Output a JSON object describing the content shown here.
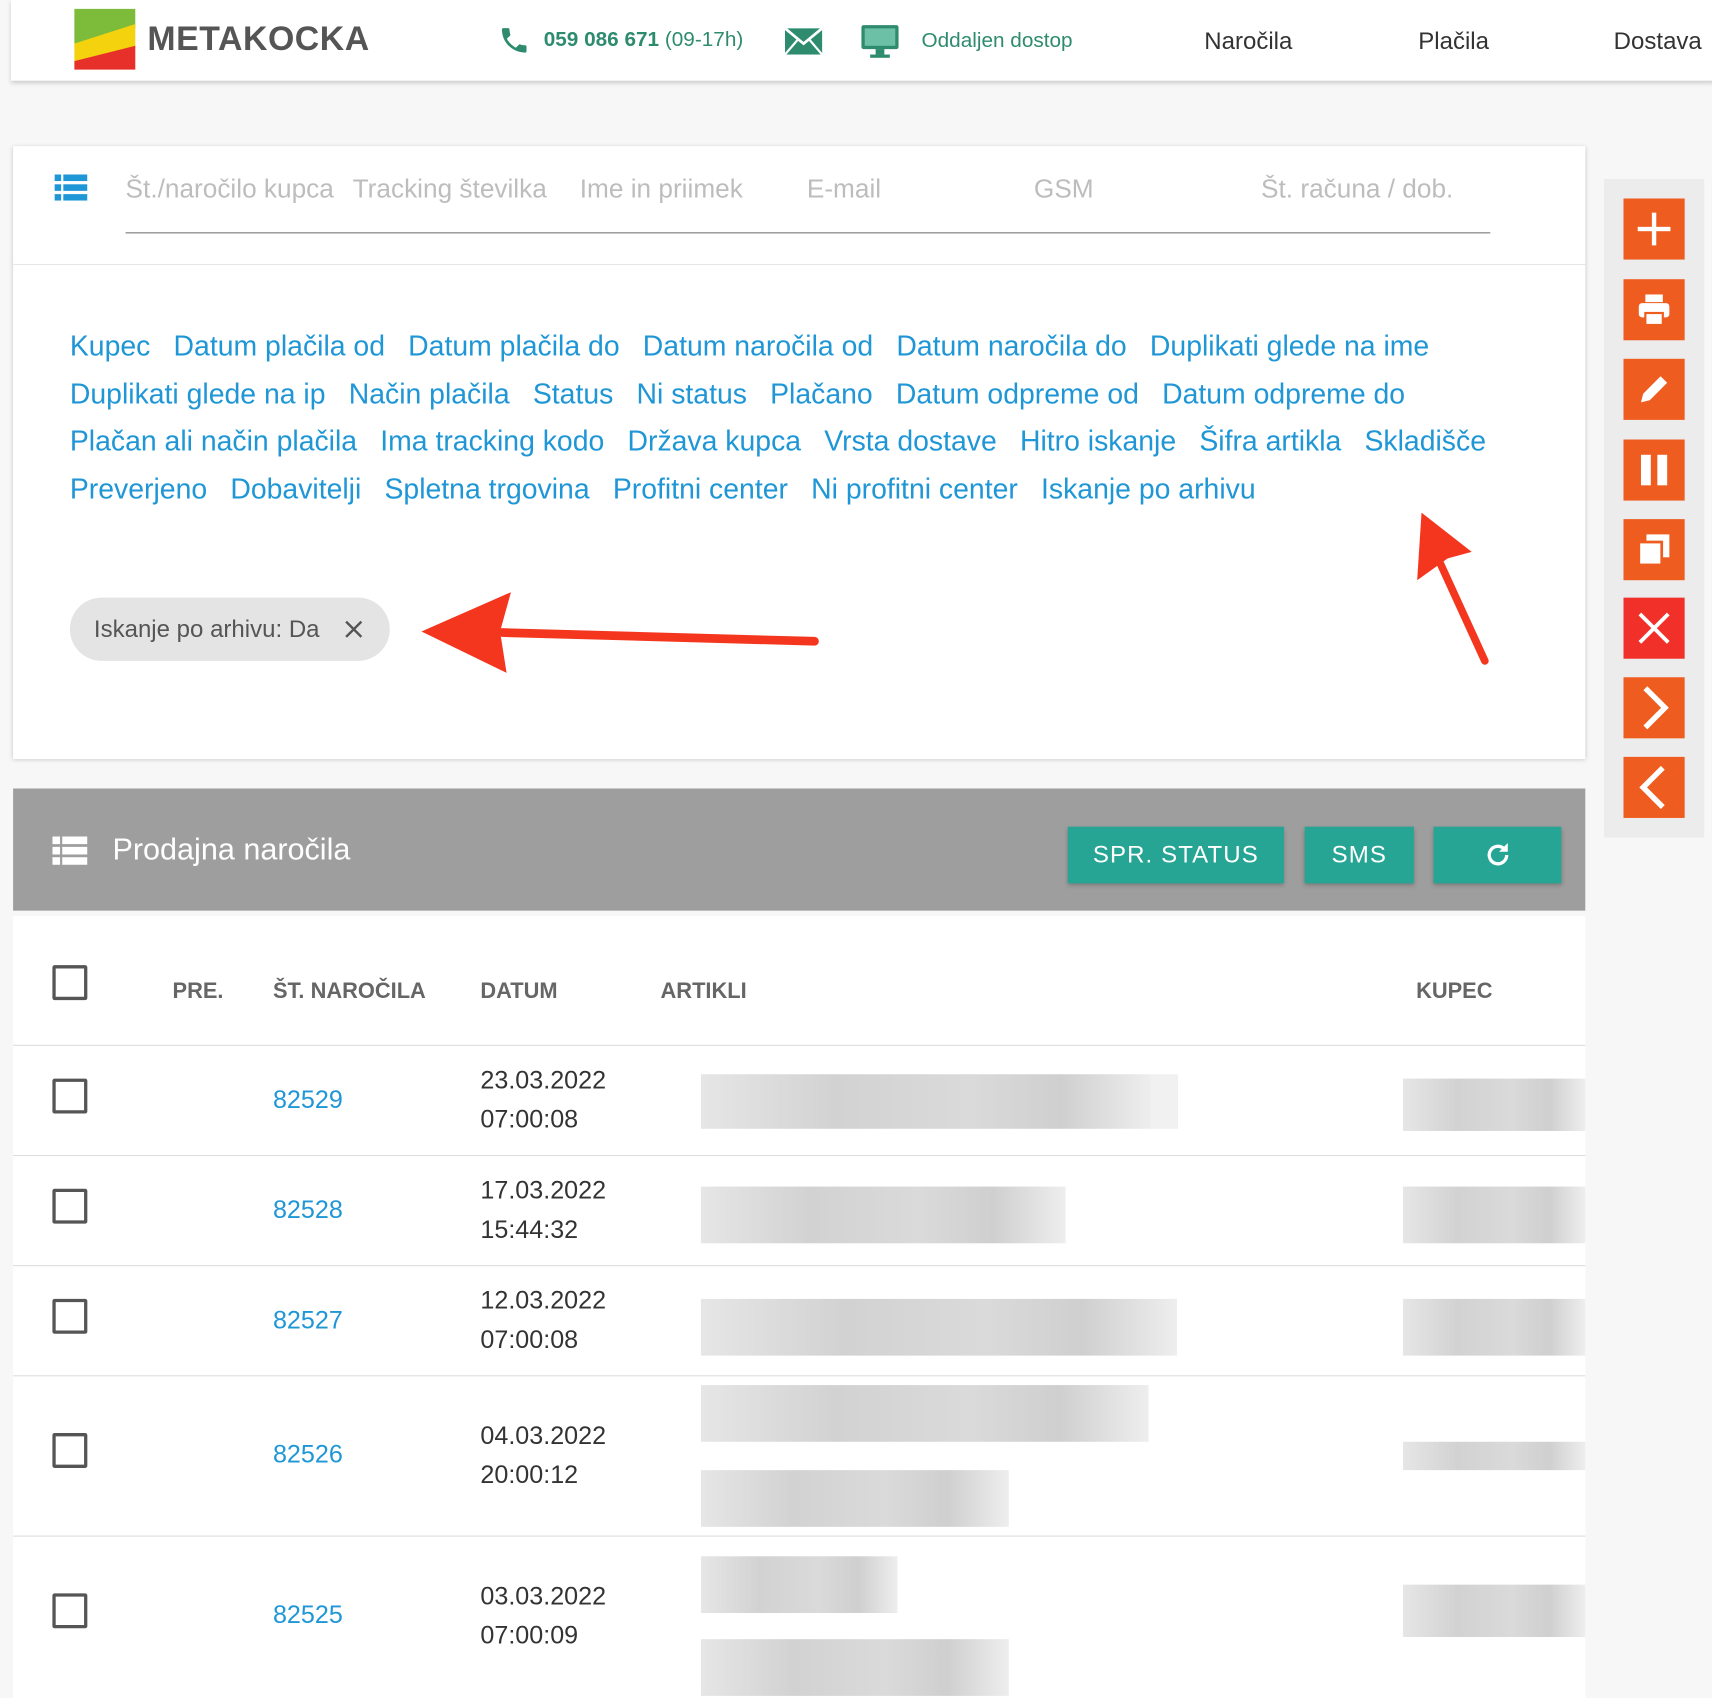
{
  "header": {
    "brand": "METAKOCKA",
    "phone_number": "059 086 671",
    "phone_hours": "(09-17h)",
    "remote_access": "Oddaljen dostop",
    "nav": [
      "Naročila",
      "Plačila",
      "Dostava"
    ]
  },
  "search": {
    "placeholders": [
      "Št./naročilo kupca",
      "Tracking številka",
      "Ime in priimek",
      "E-mail",
      "GSM",
      "Št. računa / dob."
    ]
  },
  "filters": [
    "Kupec",
    "Datum plačila od",
    "Datum plačila do",
    "Datum naročila od",
    "Datum naročila do",
    "Duplikati glede na ime",
    "Duplikati glede na ip",
    "Način plačila",
    "Status",
    "Ni status",
    "Plačano",
    "Datum odpreme od",
    "Datum odpreme do",
    "Plačan ali način plačila",
    "Ima tracking kodo",
    "Država kupca",
    "Vrsta dostave",
    "Hitro iskanje",
    "Šifra artikla",
    "Skladišče",
    "Preverjeno",
    "Dobavitelji",
    "Spletna trgovina",
    "Profitni center",
    "Ni profitni center",
    "Iskanje po arhivu"
  ],
  "active_filter_chip": "Iskanje po arhivu: Da",
  "orders": {
    "title": "Prodajna naročila",
    "buttons": {
      "status": "SPR. STATUS",
      "sms": "SMS"
    },
    "columns": {
      "pre": "PRE.",
      "number": "ŠT. NAROČILA",
      "date": "DATUM",
      "items": "ARTIKLI",
      "customer": "KUPEC"
    },
    "rows": [
      {
        "number": "82529",
        "date": "23.03.2022",
        "time": "07:00:08"
      },
      {
        "number": "82528",
        "date": "17.03.2022",
        "time": "15:44:32"
      },
      {
        "number": "82527",
        "date": "12.03.2022",
        "time": "07:00:08"
      },
      {
        "number": "82526",
        "date": "04.03.2022",
        "time": "20:00:12"
      },
      {
        "number": "82525",
        "date": "03.03.2022",
        "time": "07:00:09"
      }
    ]
  },
  "colors": {
    "accent_blue": "#1f96d6",
    "teal": "#26a595",
    "orange": "#ee5c1f",
    "red": "#f2302a",
    "green_text": "#2e8b6e"
  },
  "icons": [
    "phone-icon",
    "mail-icon",
    "monitor-icon",
    "list-icon",
    "plus-icon",
    "print-icon",
    "pencil-icon",
    "pause-icon",
    "copy-icon",
    "close-icon",
    "chevron-right-icon",
    "chevron-left-icon",
    "refresh-icon"
  ]
}
